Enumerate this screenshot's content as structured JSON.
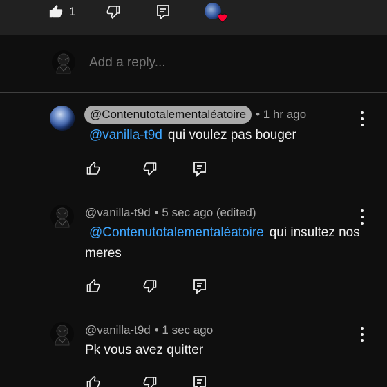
{
  "top_bar": {
    "like_count": "1",
    "icons": [
      "thumb-up-filled-icon",
      "thumb-down-icon",
      "reply-icon",
      "creator-heart-icon"
    ]
  },
  "reply_box": {
    "placeholder": "Add a reply..."
  },
  "comments": [
    {
      "author": "@Contenutotalementaléatoire",
      "time": "• 1 hr ago",
      "mention": "@vanilla-t9d",
      "text": "qui voulez pas bouger",
      "highlighted": true
    },
    {
      "author": "@vanilla-t9d",
      "time": "• 5 sec ago (edited)",
      "mention": "@Contenutotalementaléatoire",
      "text": "qui insultez nos meres",
      "highlighted": false
    },
    {
      "author": "@vanilla-t9d",
      "time": "• 1 sec ago",
      "mention": "",
      "text": "Pk vous avez quitter",
      "highlighted": false
    }
  ],
  "colors": {
    "background": "#0f0f0f",
    "top_bar": "#212121",
    "mention": "#3ea6ff",
    "heart": "#ff0033",
    "secondary_text": "#aaaaaa"
  }
}
